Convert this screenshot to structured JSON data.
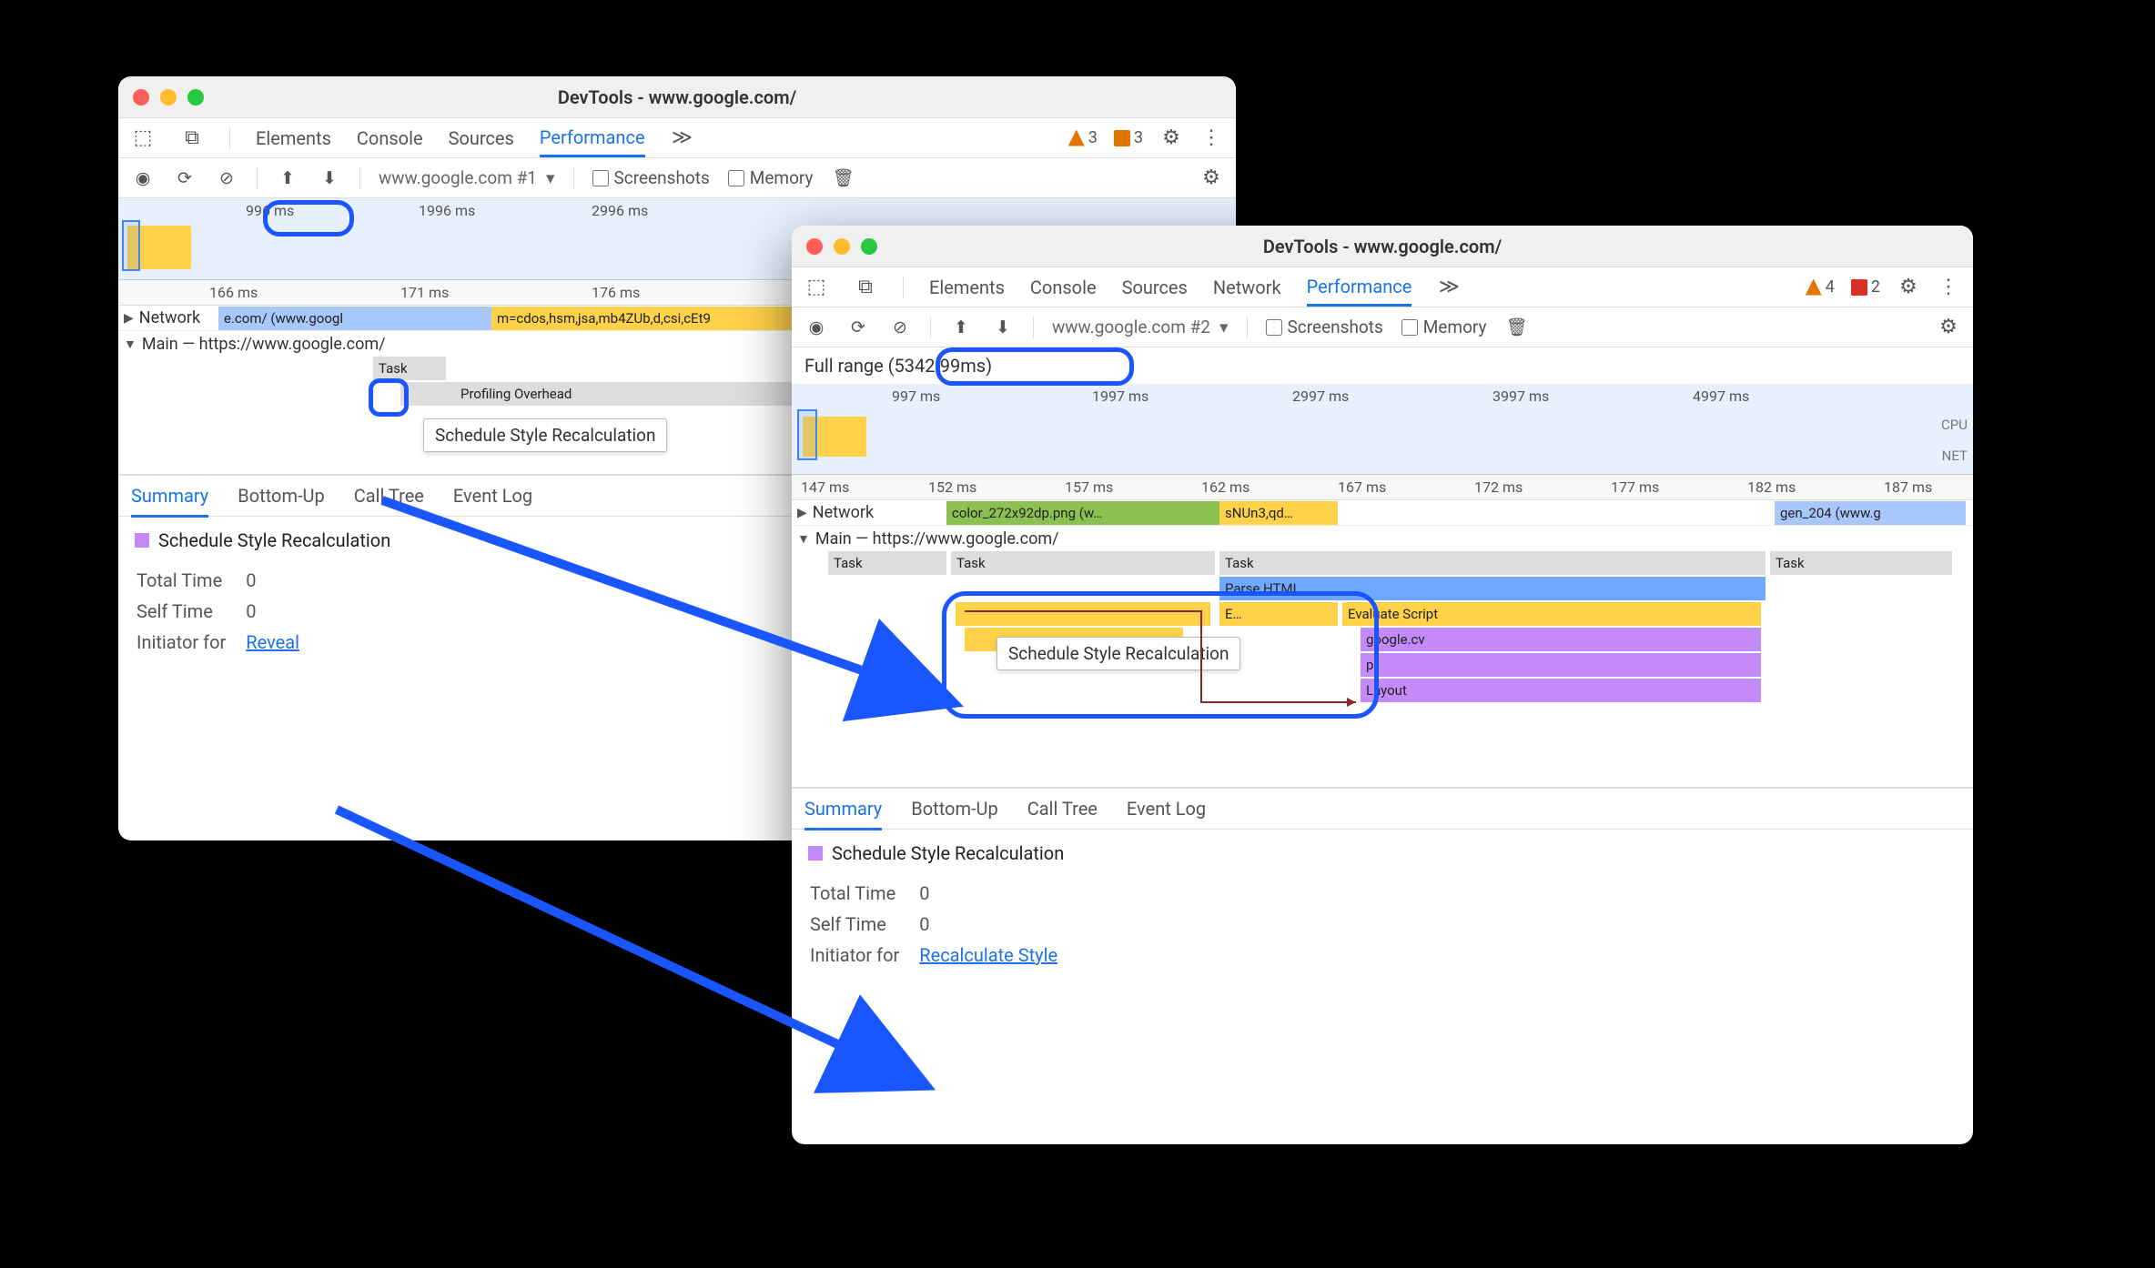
{
  "win1": {
    "title": "DevTools - www.google.com/",
    "tabs": {
      "elements": "Elements",
      "console": "Console",
      "sources": "Sources",
      "performance": "Performance"
    },
    "badges": {
      "warn": "3",
      "err": "3"
    },
    "toolbar": {
      "profile": "www.google.com #1",
      "screenshots": "Screenshots",
      "memory": "Memory"
    },
    "overview": {
      "t1": "996 ms",
      "t2": "1996 ms",
      "t3": "2996 ms"
    },
    "ruler": {
      "t1": "166 ms",
      "t2": "171 ms",
      "t3": "176 ms"
    },
    "tracks": {
      "network": "Network",
      "netseg1": "e.com/ (www.googl",
      "netseg2": "m=cdos,hsm,jsa,mb4ZUb,d,csi,cEt9",
      "main": "Main — https://www.google.com/",
      "task": "Task",
      "prof": "Profiling Overhead"
    },
    "tooltip": "Schedule Style Recalculation",
    "dtabs": {
      "summary": "Summary",
      "bottom": "Bottom-Up",
      "call": "Call Tree",
      "event": "Event Log"
    },
    "summary": {
      "title": "Schedule Style Recalculation",
      "total_l": "Total Time",
      "total_v": "0",
      "self_l": "Self Time",
      "self_v": "0",
      "init_l": "Initiator for",
      "init_v": "Reveal"
    }
  },
  "win2": {
    "title": "DevTools - www.google.com/",
    "tabs": {
      "elements": "Elements",
      "console": "Console",
      "sources": "Sources",
      "network": "Network",
      "performance": "Performance"
    },
    "badges": {
      "warn": "4",
      "err": "2"
    },
    "toolbar": {
      "profile": "www.google.com #2",
      "screenshots": "Screenshots",
      "memory": "Memory"
    },
    "range": "Full range (5342.99ms)",
    "overview": {
      "t1": "997 ms",
      "t2": "1997 ms",
      "t3": "2997 ms",
      "t4": "3997 ms",
      "t5": "4997 ms",
      "cpu": "CPU",
      "net": "NET"
    },
    "ruler": {
      "t1": "147 ms",
      "t2": "152 ms",
      "t3": "157 ms",
      "t4": "162 ms",
      "t5": "167 ms",
      "t6": "172 ms",
      "t7": "177 ms",
      "t8": "182 ms",
      "t9": "187 ms"
    },
    "tracks": {
      "network": "Network",
      "netseg1": "color_272x92dp.png (w…",
      "netseg2": "sNUn3,qd…",
      "netseg3": "gen_204 (www.g",
      "main": "Main — https://www.google.com/",
      "task": "Task",
      "parse": "Parse HTML",
      "e": "E…",
      "eval": "Evaluate Script",
      "gcv": "google.cv",
      "p": "p",
      "layout": "Layout"
    },
    "tooltip": "Schedule Style Recalculation",
    "dtabs": {
      "summary": "Summary",
      "bottom": "Bottom-Up",
      "call": "Call Tree",
      "event": "Event Log"
    },
    "summary": {
      "title": "Schedule Style Recalculation",
      "total_l": "Total Time",
      "total_v": "0",
      "self_l": "Self Time",
      "self_v": "0",
      "init_l": "Initiator for",
      "init_v": "Recalculate Style"
    }
  }
}
